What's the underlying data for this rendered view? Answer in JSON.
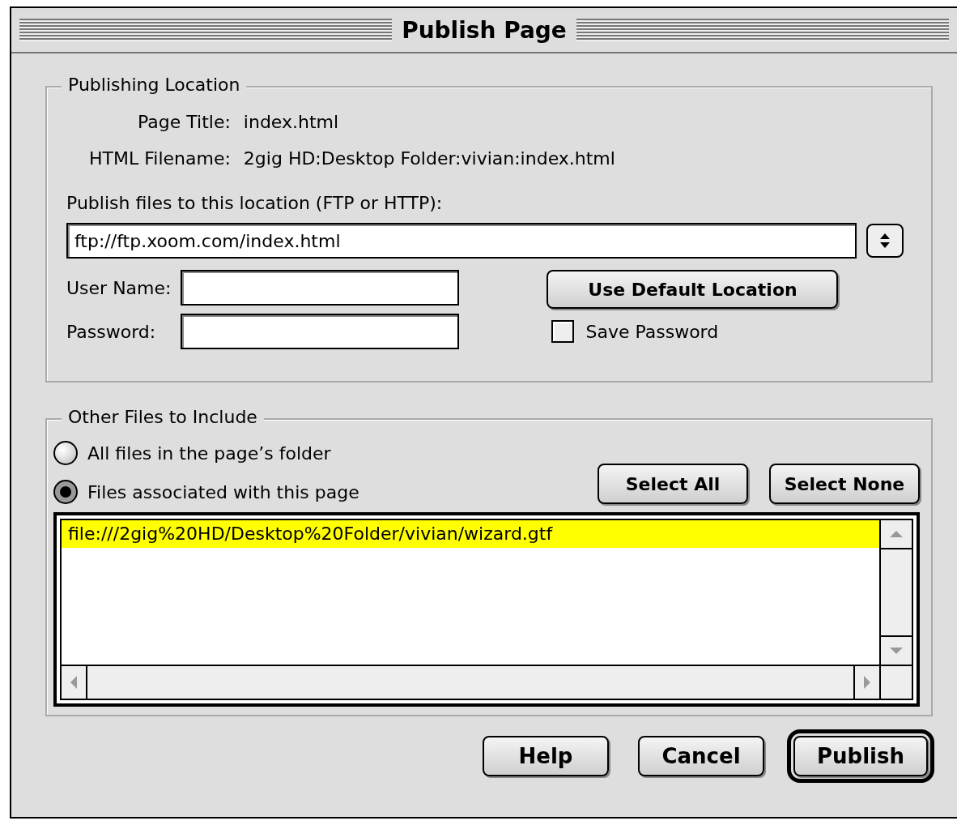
{
  "window": {
    "title": "Publish Page"
  },
  "publishing_location": {
    "legend": "Publishing Location",
    "fields": [
      {
        "label": "Page Title:",
        "value": "index.html"
      },
      {
        "label": "HTML Filename:",
        "value": "2gig HD:Desktop Folder:vivian:index.html"
      }
    ],
    "location_label": "Publish files to this location (FTP or HTTP):",
    "location": {
      "value": "ftp://ftp.xoom.com/index.html"
    },
    "user_name": {
      "label": "User Name:"
    },
    "password": {
      "label": "Password:"
    },
    "default_button": "Use Default Location",
    "save_password": {
      "label": "Save Password",
      "checked": false
    }
  },
  "other_files": {
    "legend": "Other Files to Include",
    "options": [
      {
        "label": "All files in the page’s folder",
        "selected": false
      },
      {
        "label": "Files associated with this page",
        "selected": true
      }
    ],
    "buttons": [
      "Select All",
      "Select None"
    ],
    "files": [
      {
        "path": "file:///2gig%20HD/Desktop%20Folder/vivian/wizard.gtf",
        "selected": true
      }
    ]
  },
  "buttons": [
    {
      "label": "Help",
      "default": false
    },
    {
      "label": "Cancel",
      "default": false
    },
    {
      "label": "Publish",
      "default": true
    }
  ]
}
